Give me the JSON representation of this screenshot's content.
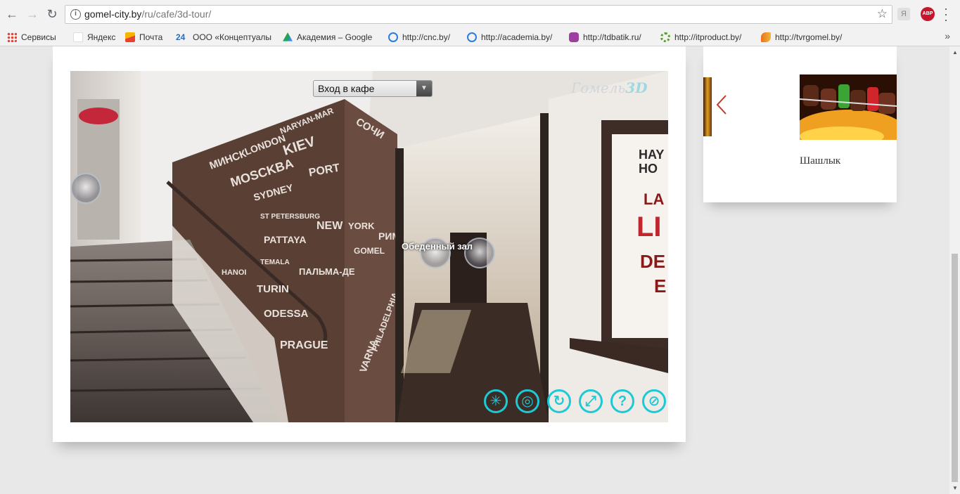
{
  "browser": {
    "url_host": "gomel-city.by",
    "url_path": "/ru/cafe/3d-tour/",
    "abp_label": "ABP",
    "yandex_ext_label": "Я",
    "bookmarks": [
      {
        "label": "Сервисы",
        "icon": "apps-grid-icon",
        "color": "#e94235"
      },
      {
        "label": "Яндекс",
        "icon": "yandex-icon",
        "color": "#ffffff"
      },
      {
        "label": "Почта",
        "icon": "mail-icon",
        "color": "#f8b500"
      },
      {
        "label": "ООО «Концептуалы",
        "icon": "site-24-icon",
        "color": "#2a6ebb"
      },
      {
        "label": "Академия – Google",
        "icon": "google-drive-icon",
        "color": "#1fa463"
      },
      {
        "label": "http://cnc.by/",
        "icon": "site-swirl-icon",
        "color": "#2a7de1"
      },
      {
        "label": "http://academia.by/",
        "icon": "site-swirl-icon",
        "color": "#2a7de1"
      },
      {
        "label": "http://tdbatik.ru/",
        "icon": "batik-icon",
        "color": "#9c3fa0"
      },
      {
        "label": "http://itproduct.by/",
        "icon": "gear-green-icon",
        "color": "#5a9e2f"
      },
      {
        "label": "http://tvrgomel.by/",
        "icon": "tvr-icon",
        "color": "#e8731c"
      }
    ],
    "more_label": "»"
  },
  "tour": {
    "scene_selected": "Вход в кафе",
    "brand_text": "Гомель",
    "brand_3d": "3D",
    "hotspot_label": "Обеденный зал",
    "controls": [
      {
        "name": "autorotate-control",
        "glyph": "✳"
      },
      {
        "name": "gyro-control",
        "glyph": "◎"
      },
      {
        "name": "rotate-control",
        "glyph": "↻"
      },
      {
        "name": "fullscreen-control",
        "glyph": "⤢"
      },
      {
        "name": "help-control",
        "glyph": "?"
      },
      {
        "name": "hide-hotspots-control",
        "glyph": "⊘"
      }
    ]
  },
  "sidebar": {
    "caption": "Шашлык"
  },
  "colors": {
    "accent_cyan": "#1ec9d6",
    "arrow_red": "#c0392b"
  }
}
